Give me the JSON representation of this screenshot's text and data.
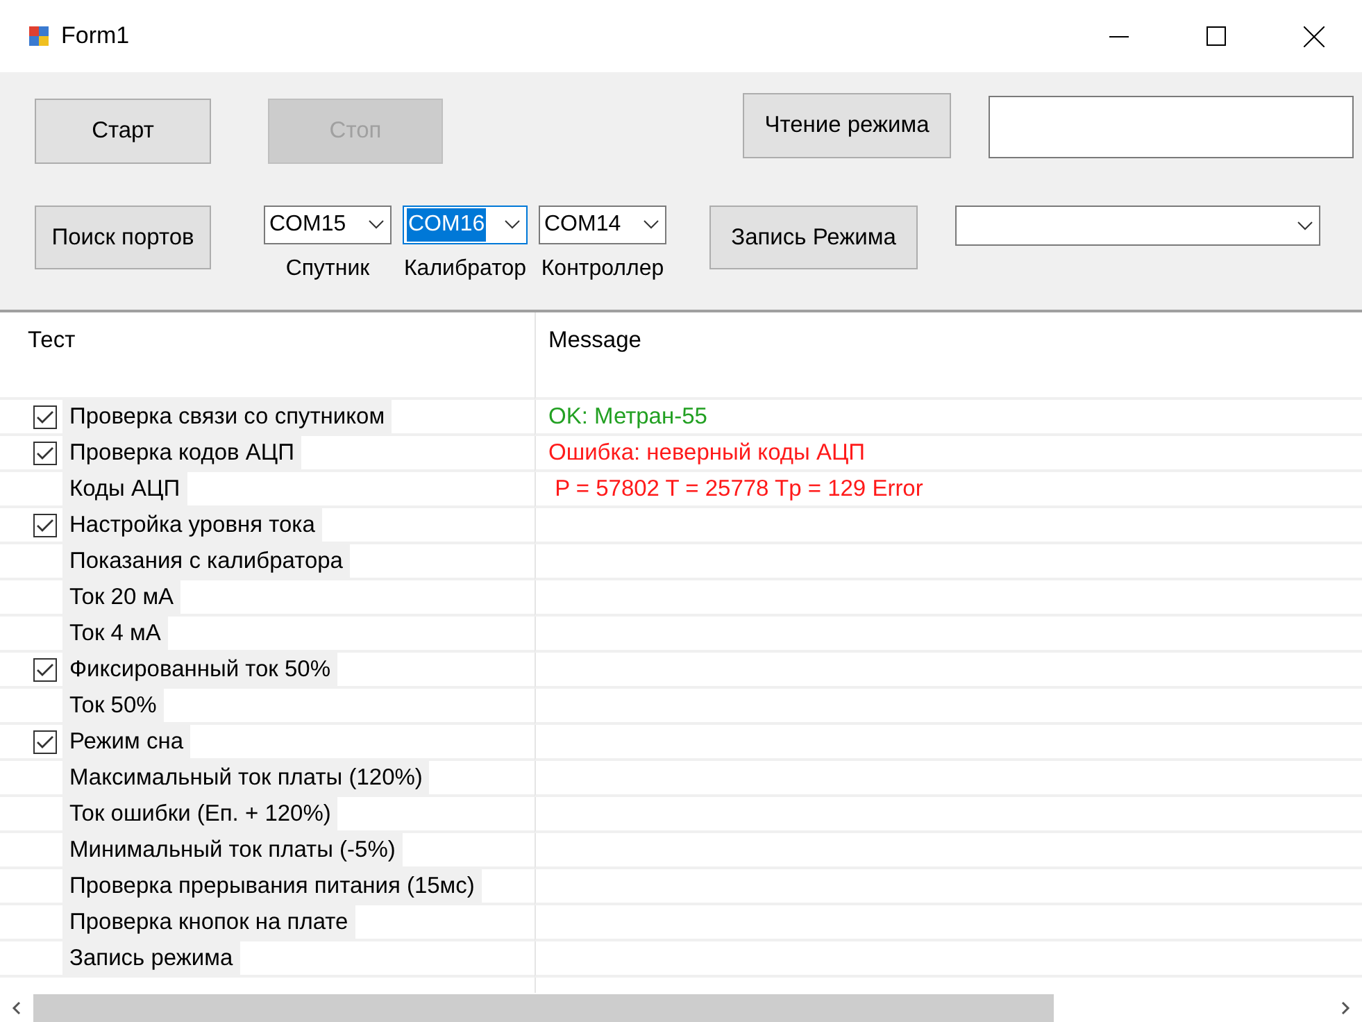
{
  "window": {
    "title": "Form1"
  },
  "toolbar": {
    "start_button": {
      "label": "Старт",
      "disabled": false
    },
    "stop_button": {
      "label": "Стоп",
      "disabled": true
    },
    "read_mode_button": {
      "label": "Чтение режима"
    },
    "write_mode_button": {
      "label": "Запись Режима"
    },
    "find_ports_button": {
      "label": "Поиск портов"
    },
    "ports": [
      {
        "value": "COM15",
        "label": "Спутник",
        "focused": false
      },
      {
        "value": "COM16",
        "label": "Калибратор",
        "focused": true
      },
      {
        "value": "COM14",
        "label": "Контроллер",
        "focused": false
      }
    ]
  },
  "table": {
    "columns": [
      "Тест",
      "Message"
    ],
    "rows": [
      {
        "kind": "check",
        "test": "Проверка связи со спутником",
        "checked": true,
        "message": "OK: Метран-55",
        "color": "#22a022"
      },
      {
        "kind": "check",
        "test": "Проверка кодов АЦП",
        "checked": true,
        "message": "Ошибка: неверный коды АЦП",
        "color": "#ff1a1a"
      },
      {
        "kind": "sub",
        "test": "Коды АЦП",
        "message": " P = 57802 T = 25778 Tp = 129 Error",
        "color": "#ff1a1a"
      },
      {
        "kind": "check",
        "test": "Настройка уровня тока",
        "checked": true
      },
      {
        "kind": "sub",
        "test": "Показания с калибратора"
      },
      {
        "kind": "sub",
        "test": "Ток 20 мА"
      },
      {
        "kind": "sub",
        "test": "Ток 4 мА"
      },
      {
        "kind": "check",
        "test": "Фиксированный ток 50%",
        "checked": true
      },
      {
        "kind": "sub",
        "test": "Ток 50%"
      },
      {
        "kind": "check",
        "test": "Режим сна",
        "checked": true
      },
      {
        "kind": "sub",
        "test": "Максимальный ток платы (120%)"
      },
      {
        "kind": "sub",
        "test": "Ток ошибки (Еп. + 120%)"
      },
      {
        "kind": "sub",
        "test": "Минимальный ток платы (-5%)"
      },
      {
        "kind": "sub",
        "test": "Проверка прерывания питания (15мс)"
      },
      {
        "kind": "sub",
        "test": "Проверка кнопок на плате"
      },
      {
        "kind": "sub",
        "test": "Запись режима"
      }
    ]
  }
}
